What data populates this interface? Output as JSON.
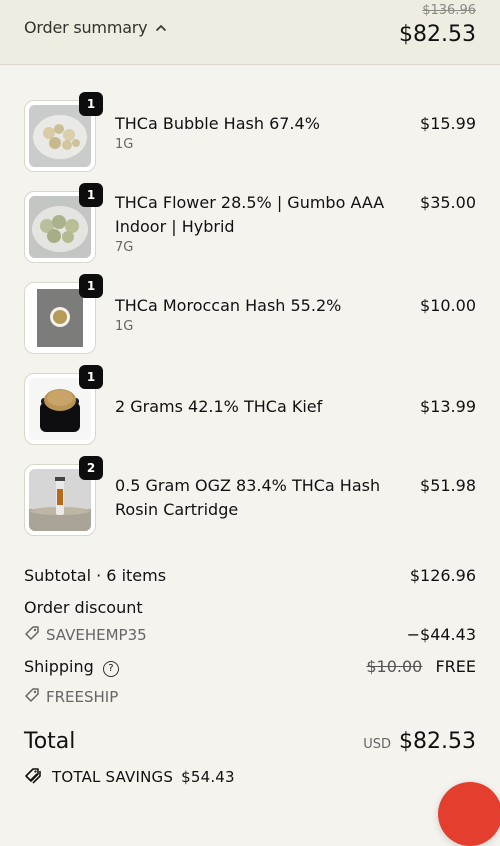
{
  "header": {
    "toggle_label": "Order summary",
    "original_total": "$136.96",
    "total": "$82.53"
  },
  "items": [
    {
      "qty": "1",
      "name": "THCa Bubble Hash 67.4%",
      "variant": "1G",
      "price": "$15.99"
    },
    {
      "qty": "1",
      "name": "THCa Flower 28.5% | Gumbo AAA Indoor | Hybrid",
      "variant": "7G",
      "price": "$35.00"
    },
    {
      "qty": "1",
      "name": "THCa Moroccan Hash 55.2%",
      "variant": "1G",
      "price": "$10.00"
    },
    {
      "qty": "1",
      "name": "2 Grams 42.1% THCa Kief",
      "variant": "",
      "price": "$13.99"
    },
    {
      "qty": "2",
      "name": "0.5 Gram OGZ 83.4% THCa Hash Rosin Cartridge",
      "variant": "",
      "price": "$51.98"
    }
  ],
  "summary": {
    "subtotal_label": "Subtotal · 6 items",
    "subtotal_value": "$126.96",
    "discount_label": "Order discount",
    "discount_code": "SAVEHEMP35",
    "discount_value": "−$44.43",
    "shipping_label": "Shipping",
    "shipping_original": "$10.00",
    "shipping_value": "FREE",
    "shipping_code": "FREESHIP",
    "total_label": "Total",
    "currency": "USD",
    "total_value": "$82.53",
    "savings_label": "TOTAL SAVINGS",
    "savings_value": "$54.43"
  },
  "colors": {
    "header_bg": "#efece2",
    "page_bg": "#f5f3ee",
    "badge": "#0d0d0d",
    "chat_button": "#e43f2e"
  }
}
